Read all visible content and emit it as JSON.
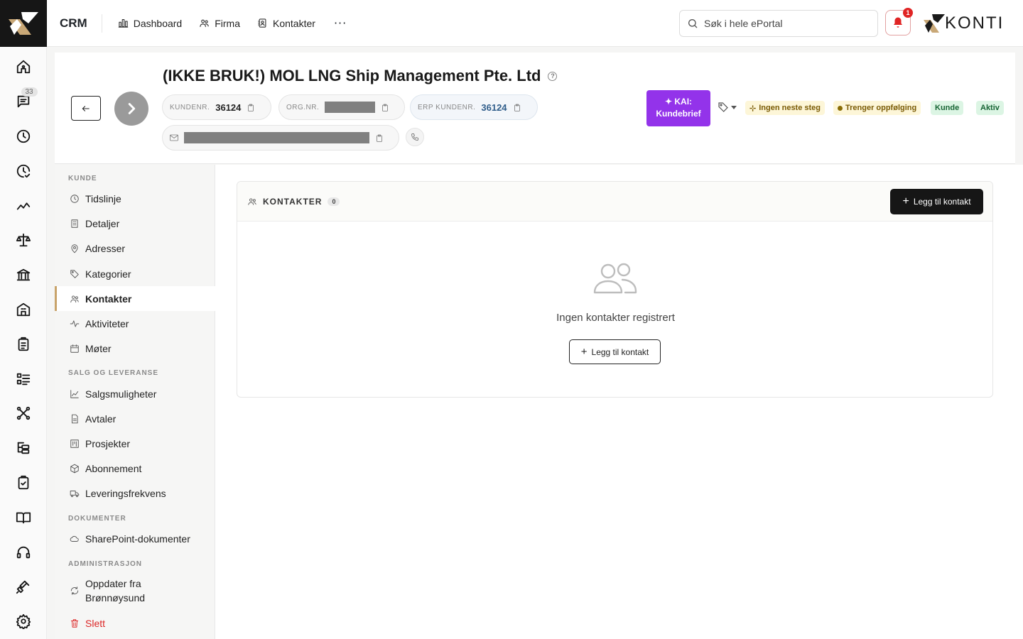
{
  "topbar": {
    "brand": "CRM",
    "nav": [
      {
        "label": "Dashboard",
        "icon": "dashboard-icon"
      },
      {
        "label": "Firma",
        "icon": "users-icon"
      },
      {
        "label": "Kontakter",
        "icon": "contact-card-icon"
      }
    ],
    "more": "···",
    "search_placeholder": "Søk i hele ePortal",
    "notification_count": "1",
    "logo_text": "KONTI"
  },
  "rail": {
    "chat_badge": "33"
  },
  "header": {
    "company_name": "(IKKE BRUK!) MOL LNG Ship Management Pte. Ltd",
    "kundenr_label": "KUNDENR.",
    "kundenr_value": "36124",
    "orgnr_label": "ORG.NR.",
    "erp_label": "ERP KUNDENR.",
    "erp_value": "36124",
    "kai_line1": "KAI:",
    "kai_line2": "Kundebrief",
    "badges": {
      "next_step": "Ingen neste steg",
      "followup": "Trenger oppfølging",
      "type": "Kunde",
      "status": "Aktiv"
    }
  },
  "sidenav": {
    "sections": {
      "kunde": "KUNDE",
      "salg": "SALG OG LEVERANSE",
      "dokumenter": "DOKUMENTER",
      "admin": "ADMINISTRASJON"
    },
    "items": {
      "tidslinje": "Tidslinje",
      "detaljer": "Detaljer",
      "adresser": "Adresser",
      "kategorier": "Kategorier",
      "kontakter": "Kontakter",
      "aktiviteter": "Aktiviteter",
      "moter": "Møter",
      "salgsmuligheter": "Salgsmuligheter",
      "avtaler": "Avtaler",
      "prosjekter": "Prosjekter",
      "abonnement": "Abonnement",
      "leveringsfrekvens": "Leveringsfrekvens",
      "sharepoint": "SharePoint-dokumenter",
      "oppdater_line1": "Oppdater fra",
      "oppdater_line2": "Brønnøysund",
      "slett": "Slett"
    }
  },
  "contacts_card": {
    "title": "KONTAKTER",
    "count": "0",
    "add_button": "Legg til kontakt",
    "empty_text": "Ingen kontakter registrert",
    "empty_add_button": "Legg til kontakt"
  },
  "colors": {
    "accent_purple": "#9333ea",
    "active_nav_border": "#c8a36a",
    "danger": "#dc2626",
    "notification": "#e02424"
  }
}
